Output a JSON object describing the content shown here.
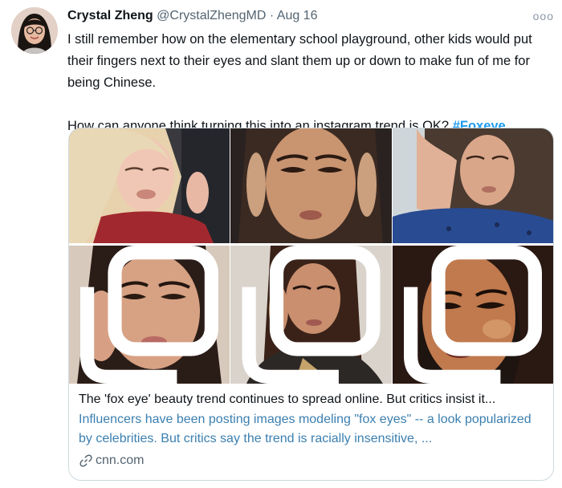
{
  "tweet": {
    "author_name": "Crystal Zheng",
    "handle": "@CrystalZhengMD",
    "separator": "·",
    "date": "Aug 16",
    "more_icon": "ooo",
    "paragraph_1": "I still remember how on the elementary school playground, other kids would put their fingers next to their eyes and slant them up or down to make fun of me for being Chinese.",
    "paragraph_2_text": "How can anyone think turning this into an instagram trend is OK?",
    "hashtag": "#Foxeye"
  },
  "card": {
    "title": "The 'fox eye' beauty trend continues to spread online. But critics insist it...",
    "description": "Influencers have been posting images modeling \"fox eyes\" -- a look popularized by celebrities. But critics say the trend is racially insensitive, ...",
    "domain": "cnn.com",
    "link_icon": "link-icon",
    "photo_tiles": 6,
    "multi_image_badge_icon": "gallery-icon"
  },
  "colors": {
    "accent": "#1d9bf0",
    "link_text": "#3b7fb0",
    "secondary_text": "#536471",
    "border": "#cfd9de"
  }
}
